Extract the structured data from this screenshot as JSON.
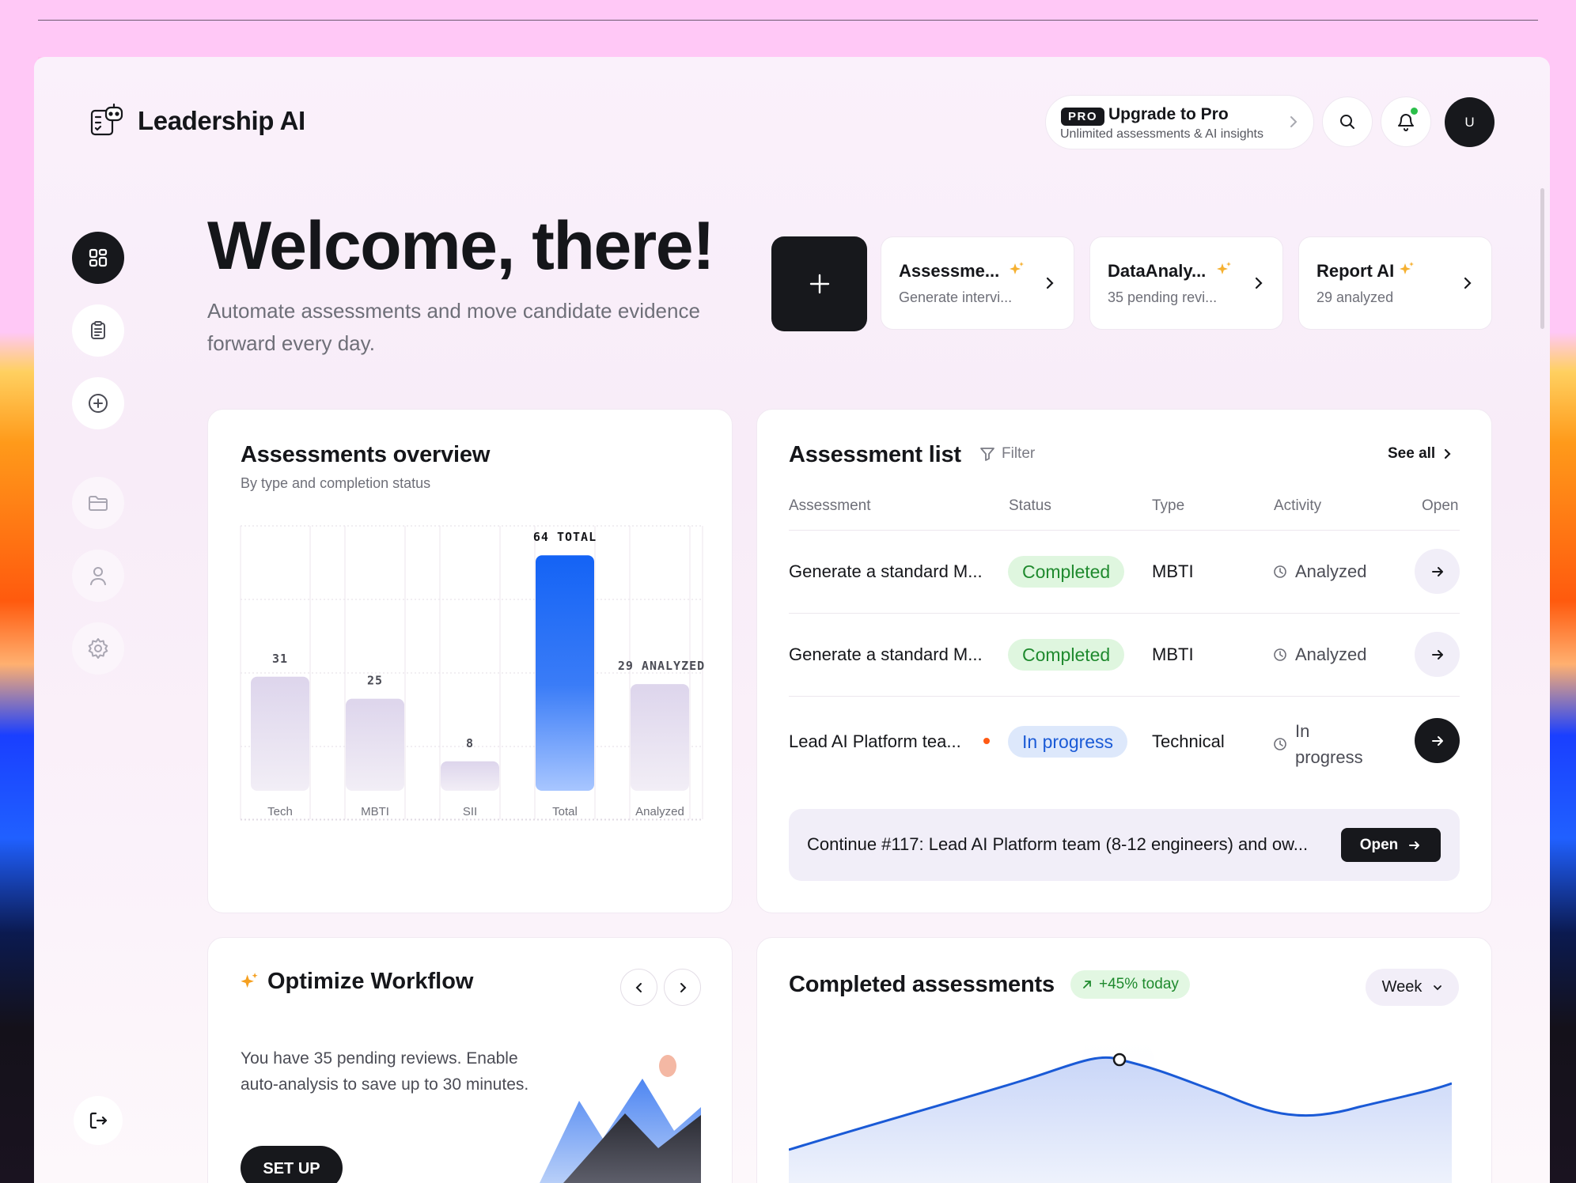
{
  "app": {
    "name": "Leadership AI"
  },
  "header": {
    "pro_badge": "PRO",
    "upgrade_title": "Upgrade to Pro",
    "upgrade_subtitle": "Unlimited assessments & AI insights",
    "avatar_initial": "U"
  },
  "sidebar": {
    "items": [
      {
        "icon": "dashboard-icon",
        "active": true
      },
      {
        "icon": "clipboard-icon",
        "active": false
      },
      {
        "icon": "plus-circle-icon",
        "active": false
      },
      {
        "icon": "folder-icon",
        "active": false
      },
      {
        "icon": "user-icon",
        "active": false
      },
      {
        "icon": "settings-icon",
        "active": false
      }
    ],
    "logout_icon": "logout-icon"
  },
  "welcome": {
    "title": "Welcome, there!",
    "subtitle": "Automate assessments and move candidate evidence forward every day."
  },
  "tools": [
    {
      "title": "Assessme...",
      "subtitle": "Generate intervi..."
    },
    {
      "title": "DataAnaly...",
      "subtitle": "35 pending revi..."
    },
    {
      "title": "Report AI",
      "subtitle": "29 analyzed"
    }
  ],
  "overview": {
    "title": "Assessments overview",
    "subtitle": "By type and completion status"
  },
  "chart_data": {
    "type": "bar",
    "categories": [
      "Tech",
      "MBTI",
      "SII",
      "Total",
      "Analyzed"
    ],
    "values": [
      31,
      25,
      8,
      64,
      29
    ],
    "value_labels": [
      "31",
      "25",
      "8",
      "64 TOTAL",
      "29 ANALYZED"
    ],
    "highlight_category": "Total",
    "ylim": [
      0,
      72
    ],
    "grid": true,
    "colors": {
      "bar": "#e3dcee",
      "highlight_top": "#1463f5",
      "highlight_bottom": "#9cc0ff"
    }
  },
  "assessment_list": {
    "title": "Assessment list",
    "filter_label": "Filter",
    "see_all_label": "See all",
    "columns": [
      "Assessment",
      "Status",
      "Type",
      "Activity",
      "Open"
    ],
    "rows": [
      {
        "name": "Generate a standard M...",
        "status": "Completed",
        "type": "MBTI",
        "activity": "Analyzed"
      },
      {
        "name": "Generate a standard M...",
        "status": "Completed",
        "type": "MBTI",
        "activity": "Analyzed"
      },
      {
        "name": "Lead AI Platform tea...",
        "status": "In progress",
        "type": "Technical",
        "activity_line1": "In",
        "activity_line2": "progress"
      }
    ],
    "continue_text": "Continue #117: Lead AI Platform team (8-12 engineers) and ow...",
    "continue_button": "Open"
  },
  "optimize": {
    "title": "Optimize Workflow",
    "text": "You have 35 pending reviews. Enable auto-analysis to save up to 30 minutes.",
    "button": "SET UP"
  },
  "completed": {
    "title": "Completed assessments",
    "badge": "+45% today",
    "period": "Week"
  }
}
